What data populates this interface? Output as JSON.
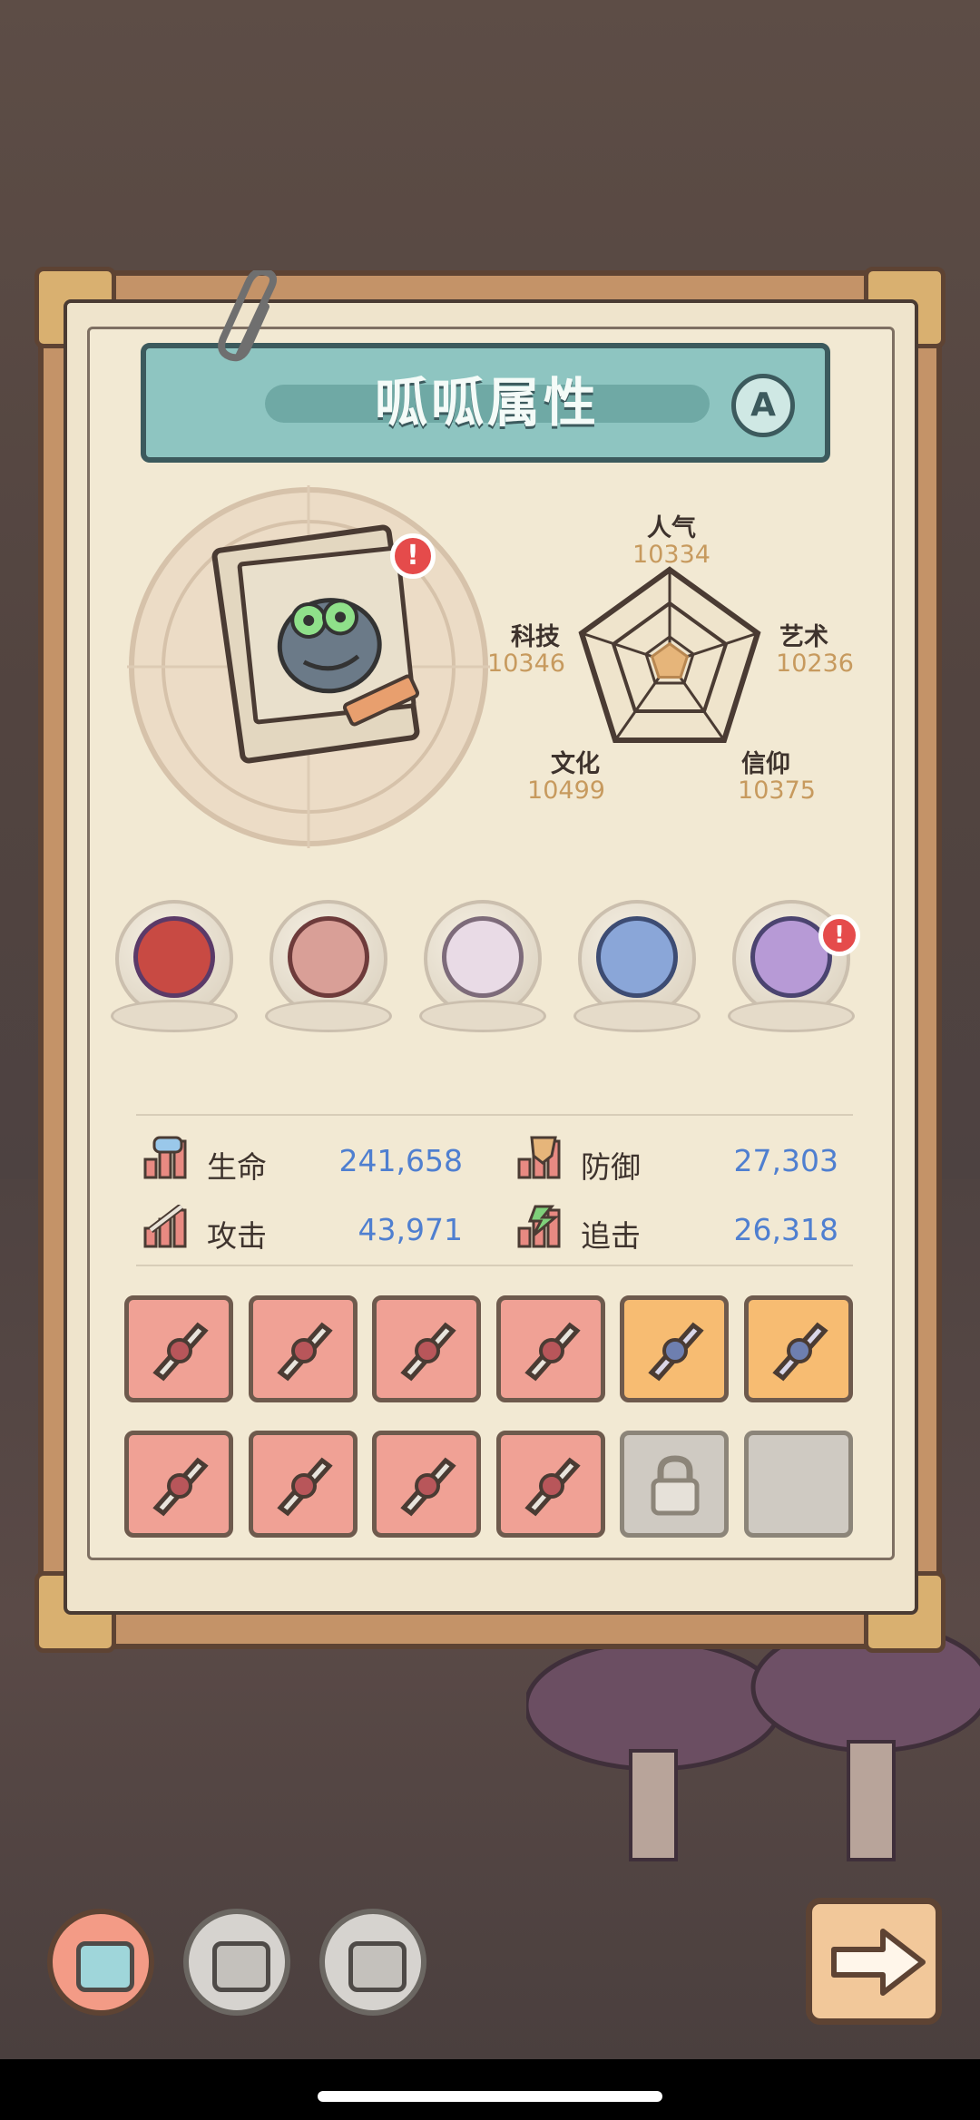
{
  "title": "呱呱属性",
  "grade": "A",
  "alert_mark": "!",
  "attributes": [
    {
      "name": "人气",
      "value": "10334"
    },
    {
      "name": "艺术",
      "value": "10236"
    },
    {
      "name": "信仰",
      "value": "10375"
    },
    {
      "name": "文化",
      "value": "10499"
    },
    {
      "name": "科技",
      "value": "10346"
    }
  ],
  "radar_levels": [
    0.2,
    0.2,
    0.2,
    0.2,
    0.2
  ],
  "relics": [
    {
      "icon": "tentacle-bone-relic-icon",
      "alert": false
    },
    {
      "icon": "fanged-mouth-relic-icon",
      "alert": false
    },
    {
      "icon": "garlic-relic-icon",
      "alert": false
    },
    {
      "icon": "compass-relic-icon",
      "alert": false
    },
    {
      "icon": "crystal-box-relic-icon",
      "alert": true
    }
  ],
  "stats": {
    "hp": {
      "label": "生命",
      "value": "241,658",
      "icon": "heart-bar-icon"
    },
    "defense": {
      "label": "防御",
      "value": "27,303",
      "icon": "shield-bar-icon"
    },
    "attack": {
      "label": "攻击",
      "value": "43,971",
      "icon": "sword-bar-icon"
    },
    "chase": {
      "label": "追击",
      "value": "26,318",
      "icon": "lightning-bar-icon"
    }
  },
  "equipment": [
    {
      "icon": "sword-icon",
      "rarity": "red"
    },
    {
      "icon": "spiked-gun-icon",
      "rarity": "red"
    },
    {
      "icon": "dagger-icon",
      "rarity": "red"
    },
    {
      "icon": "crossbow-icon",
      "rarity": "red"
    },
    {
      "icon": "bracer-icon",
      "rarity": "orange"
    },
    {
      "icon": "vest-armor-icon",
      "rarity": "orange"
    },
    {
      "icon": "horned-helmet-icon",
      "rarity": "red"
    },
    {
      "icon": "mace-icon",
      "rarity": "red"
    },
    {
      "icon": "leg-armor-icon",
      "rarity": "red"
    },
    {
      "icon": "blaster-icon",
      "rarity": "red"
    },
    {
      "icon": "lock-icon",
      "rarity": "locked"
    },
    {
      "icon": "",
      "rarity": "empty"
    }
  ],
  "bottom_nav": [
    {
      "icon": "robot-face-icon",
      "active": true
    },
    {
      "icon": "robot-face-icon",
      "active": false
    },
    {
      "icon": "robot-face-icon",
      "active": false
    }
  ],
  "colors": {
    "stat_value": "#4f7fd0",
    "attr_value": "#c79a5e",
    "red_slot": "#f0a195",
    "orange_slot": "#f7bc72",
    "banner": "#8ec5c1"
  }
}
